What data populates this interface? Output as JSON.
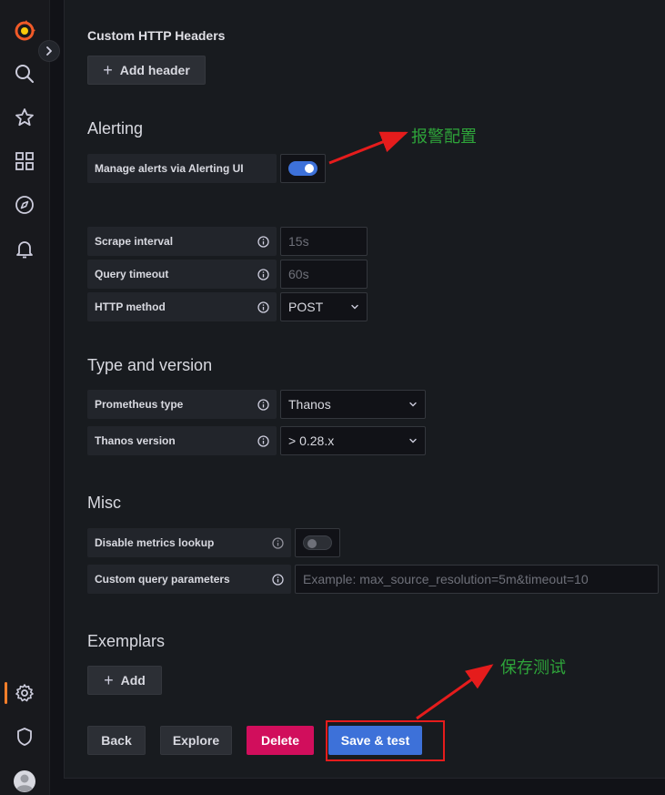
{
  "sidebar": {
    "items": [
      {
        "icon": "grafana-logo-icon"
      },
      {
        "icon": "search-icon"
      },
      {
        "icon": "star-icon"
      },
      {
        "icon": "dashboards-grid-icon"
      },
      {
        "icon": "explore-compass-icon"
      },
      {
        "icon": "alerting-bell-icon"
      },
      {
        "icon": "configuration-gear-icon",
        "active": true
      },
      {
        "icon": "server-admin-shield-icon"
      },
      {
        "icon": "user-avatar-icon"
      }
    ],
    "active_color": "#ff7f2a"
  },
  "custom_headers": {
    "title": "Custom HTTP Headers",
    "add_header_label": "Add header"
  },
  "alerting": {
    "title": "Alerting",
    "manage_alerts_label": "Manage alerts via Alerting UI",
    "manage_alerts_enabled": true
  },
  "prometheus_settings": {
    "scrape_interval_label": "Scrape interval",
    "scrape_interval_placeholder": "15s",
    "query_timeout_label": "Query timeout",
    "query_timeout_placeholder": "60s",
    "http_method_label": "HTTP method",
    "http_method_value": "POST"
  },
  "type_and_version": {
    "title": "Type and version",
    "prometheus_type_label": "Prometheus type",
    "prometheus_type_value": "Thanos",
    "thanos_version_label": "Thanos version",
    "thanos_version_value": "> 0.28.x"
  },
  "misc": {
    "title": "Misc",
    "disable_metrics_lookup_label": "Disable metrics lookup",
    "disable_metrics_lookup_enabled": false,
    "custom_query_params_label": "Custom query parameters",
    "custom_query_params_placeholder": "Example: max_source_resolution=5m&timeout=10"
  },
  "exemplars": {
    "title": "Exemplars",
    "add_label": "Add"
  },
  "actions": {
    "back_label": "Back",
    "explore_label": "Explore",
    "delete_label": "Delete",
    "save_test_label": "Save & test"
  },
  "annotations": {
    "alert_config_note": "报警配置",
    "save_test_note": "保存测试"
  },
  "colors": {
    "primary": "#3d71d9",
    "danger": "#d10e5c",
    "annotation_text": "#2ea43a",
    "annotation_arrow": "#e51c1c"
  }
}
